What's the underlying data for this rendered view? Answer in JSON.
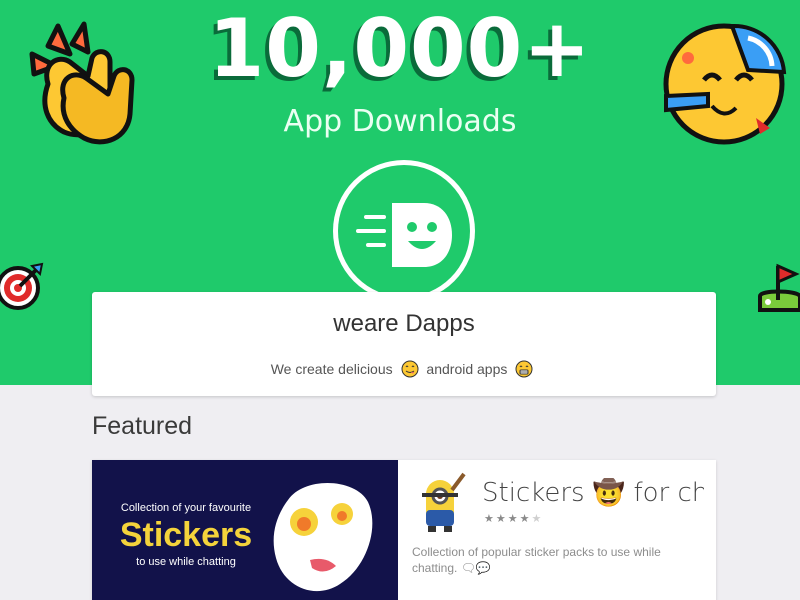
{
  "hero": {
    "count": "10,000+",
    "count_label": "App Downloads",
    "colors": {
      "background": "#1fca6b",
      "count_shadow": "#0a6b3a"
    }
  },
  "decorations": {
    "left_top": "clapping-hands-icon",
    "right_top": "party-face-icon",
    "left_mid": "bullseye-icon",
    "right_mid": "golf-flag-icon"
  },
  "profile": {
    "name": "weare Dapps",
    "tagline_before": "We create delicious",
    "tagline_after": "android apps",
    "tag_icons": [
      "yum-face-icon",
      "grin-face-icon"
    ]
  },
  "featured": {
    "title": "Featured",
    "card": {
      "banner_line1": "Collection of your favourite",
      "banner_big": "Stickers",
      "banner_line2": "to use while chatting",
      "app_title": "Stickers 🤠 for chatting",
      "rating": 4,
      "rating_max": 5,
      "desc": "Collection of popular sticker packs to use while chatting. 🗨💬"
    }
  }
}
